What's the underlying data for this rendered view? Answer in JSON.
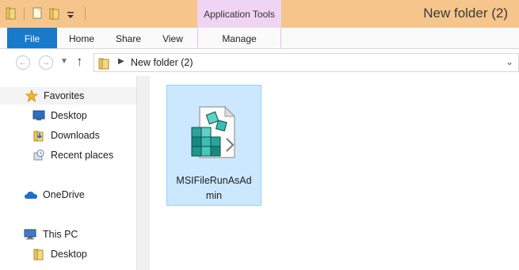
{
  "window": {
    "title": "New folder (2)"
  },
  "quick_access": {
    "icons": [
      "folder-icon",
      "properties-icon",
      "new-folder-icon",
      "customize-qat-icon"
    ]
  },
  "contextual_tab": {
    "label": "Application Tools"
  },
  "ribbon": {
    "tabs": [
      {
        "label": "File",
        "active": true
      },
      {
        "label": "Home"
      },
      {
        "label": "Share"
      },
      {
        "label": "View"
      },
      {
        "label": "Manage"
      }
    ]
  },
  "address": {
    "path": "New folder (2)",
    "icons": [
      "back-arrow-icon",
      "forward-arrow-icon",
      "recent-dropdown-icon",
      "up-arrow-icon",
      "folder-icon",
      "chevron-right-icon",
      "chevron-down-icon"
    ]
  },
  "nav": {
    "favorites": {
      "label": "Favorites",
      "icon": "star-icon"
    },
    "favorites_items": [
      {
        "label": "Desktop",
        "icon": "desktop-icon"
      },
      {
        "label": "Downloads",
        "icon": "downloads-icon"
      },
      {
        "label": "Recent places",
        "icon": "recent-places-icon"
      }
    ],
    "onedrive": {
      "label": "OneDrive",
      "icon": "cloud-icon"
    },
    "thispc": {
      "label": "This PC",
      "icon": "computer-icon"
    },
    "thispc_items": [
      {
        "label": "Desktop",
        "icon": "folder-icon"
      }
    ]
  },
  "content": {
    "files": [
      {
        "name_line1": "MSIFileRunAsAd",
        "name_line2": "min",
        "icon": "registry-file-icon",
        "selected": true
      }
    ]
  },
  "colors": {
    "titlebar": "#f6c58c",
    "contextual_tab": "#f0d4f3",
    "file_tab": "#1979ca",
    "selection_fill": "#cce8ff",
    "selection_border": "#99d1ff"
  }
}
